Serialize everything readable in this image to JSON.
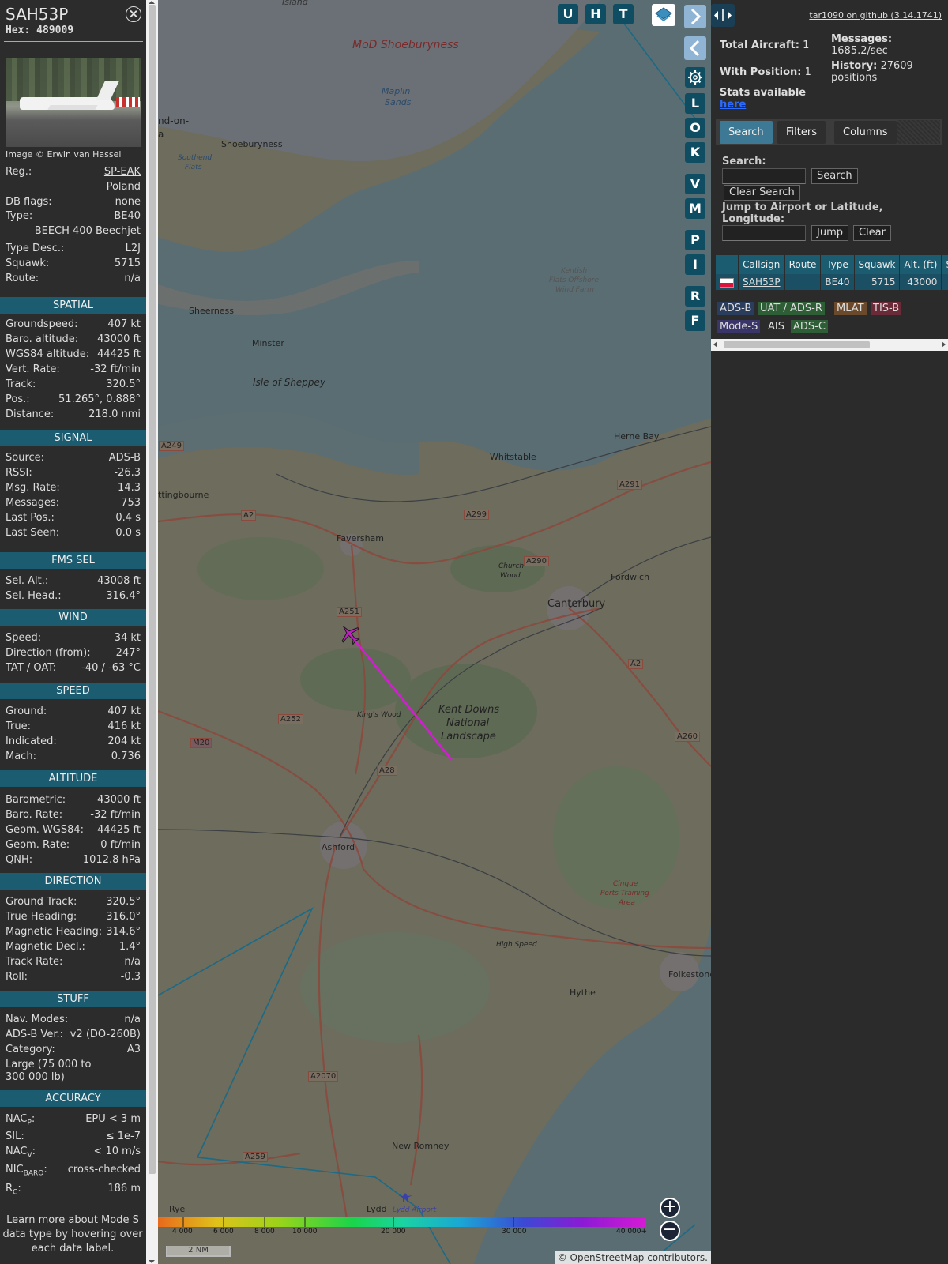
{
  "aircraft": {
    "callsign": "SAH53P",
    "hex_label": "Hex:",
    "hex": "489009",
    "photo_credit": "Image © Erwin van Hassel",
    "reg_label": "Reg.:",
    "reg": "SP-EAK",
    "country": "Poland",
    "dbflags_label": "DB flags:",
    "dbflags": "none",
    "type_label": "Type:",
    "type": "BE40",
    "type_name": "BEECH 400 Beechjet",
    "typedesc_label": "Type Desc.:",
    "typedesc": "L2J",
    "squawk_label": "Squawk:",
    "squawk": "5715",
    "route_label": "Route:",
    "route": "n/a"
  },
  "sections": {
    "spatial": "SPATIAL",
    "signal": "SIGNAL",
    "fms": "FMS SEL",
    "wind": "WIND",
    "speed": "SPEED",
    "altitude": "ALTITUDE",
    "direction": "DIRECTION",
    "stuff": "STUFF",
    "accuracy": "ACCURACY"
  },
  "spatial": [
    {
      "k": "Groundspeed:",
      "v": "407 kt"
    },
    {
      "k": "Baro. altitude:",
      "v": "43000 ft"
    },
    {
      "k": "WGS84 altitude:",
      "v": "44425 ft"
    },
    {
      "k": "Vert. Rate:",
      "v": "-32 ft/min"
    },
    {
      "k": "Track:",
      "v": "320.5°"
    },
    {
      "k": "Pos.:",
      "v": "51.265°, 0.888°"
    },
    {
      "k": "Distance:",
      "v": "218.0 nmi"
    }
  ],
  "signal": [
    {
      "k": "Source:",
      "v": "ADS-B"
    },
    {
      "k": "RSSI:",
      "v": "-26.3"
    },
    {
      "k": "Msg. Rate:",
      "v": "14.3"
    },
    {
      "k": "Messages:",
      "v": "753"
    },
    {
      "k": "Last Pos.:",
      "v": "0.4 s"
    },
    {
      "k": "Last Seen:",
      "v": "0.0 s"
    }
  ],
  "fms": [
    {
      "k": "Sel. Alt.:",
      "v": "43008 ft"
    },
    {
      "k": "Sel. Head.:",
      "v": "316.4°"
    }
  ],
  "wind": [
    {
      "k": "Speed:",
      "v": "34 kt"
    },
    {
      "k": "Direction (from):",
      "v": "247°"
    },
    {
      "k": "TAT / OAT:",
      "v": "-40 / -63 °C"
    }
  ],
  "speed": [
    {
      "k": "Ground:",
      "v": "407 kt"
    },
    {
      "k": "True:",
      "v": "416 kt"
    },
    {
      "k": "Indicated:",
      "v": "204 kt"
    },
    {
      "k": "Mach:",
      "v": "0.736"
    }
  ],
  "altitude": [
    {
      "k": "Barometric:",
      "v": "43000 ft"
    },
    {
      "k": "Baro. Rate:",
      "v": "-32 ft/min"
    },
    {
      "k": "Geom. WGS84:",
      "v": "44425 ft"
    },
    {
      "k": "Geom. Rate:",
      "v": "0 ft/min"
    },
    {
      "k": "QNH:",
      "v": "1012.8 hPa"
    }
  ],
  "direction": [
    {
      "k": "Ground Track:",
      "v": "320.5°"
    },
    {
      "k": "True Heading:",
      "v": "316.0°"
    },
    {
      "k": "Magnetic Heading:",
      "v": "314.6°"
    },
    {
      "k": "Magnetic Decl.:",
      "v": "1.4°"
    },
    {
      "k": "Track Rate:",
      "v": "n/a"
    },
    {
      "k": "Roll:",
      "v": "-0.3"
    }
  ],
  "stuff": [
    {
      "k": "Nav. Modes:",
      "v": "n/a"
    },
    {
      "k": "ADS-B Ver.:",
      "v": "v2 (DO-260B)"
    },
    {
      "k": "Category:",
      "v": "A3"
    }
  ],
  "stuff_category_desc_1": "Large (75 000 to",
  "stuff_category_desc_2": "300 000 lb)",
  "accuracy": {
    "nacp_k": "NAC",
    "nacp_sub": "P",
    "nacp_v": "EPU < 3 m",
    "sil_k": "SIL:",
    "sil_v": "≤ 1e-7",
    "nacv_k": "NAC",
    "nacv_sub": "V",
    "nacv_v": "< 10 m/s",
    "nic_k": "NIC",
    "nic_sub": "BARO",
    "nic_v": "cross-checked",
    "rc_k": "R",
    "rc_sub": "C",
    "rc_v": "186 m"
  },
  "learn_more_1": "Learn more about Mode S",
  "learn_more_2": "data type by hovering over",
  "learn_more_3": "each data label.",
  "map": {
    "buttons_top": [
      "U",
      "H",
      "T"
    ],
    "buttons_side": [
      "L",
      "O",
      "K",
      "V",
      "M",
      "P",
      "I",
      "R",
      "F"
    ],
    "scale": "2 NM",
    "attribution_prefix": "© ",
    "attribution_link": "OpenStreetMap",
    "attribution_suffix": " contributors.",
    "zoom_in": "+",
    "zoom_out": "−",
    "labels": {
      "island": "Island",
      "shoebury_mod": "MoD Shoeburyness",
      "maplin": "Maplin",
      "sands": "Sands",
      "endon": "nd-on-",
      "endon2": "a",
      "shoeburyness": "Shoeburyness",
      "southend": "Southend",
      "flats": "Flats",
      "kentish": "Kentish",
      "flats_offshore": "Flats Offshore",
      "windfarm": "Wind Farm",
      "sheerness": "Sheerness",
      "minster": "Minster",
      "sheppey": "Isle of Sheppey",
      "herne_bay": "Herne Bay",
      "whitstable": "Whitstable",
      "sittingbourne": "ttingbourne",
      "faversham": "Faversham",
      "church": "Church",
      "wood": "Wood",
      "fordwich": "Fordwich",
      "canterbury": "Canterbury",
      "kent_downs": "Kent Downs",
      "national": "National",
      "landscape": "Landscape",
      "kings_wood": "King's Wood",
      "ashford": "Ashford",
      "cinque": "Cinque",
      "ports_training": "Ports Training",
      "area": "Area",
      "high_speed": "High Speed",
      "folkestone": "Folkestone",
      "hythe": "Hythe",
      "new_romney": "New Romney",
      "rye": "Rye",
      "lydd": "Lydd",
      "lydd_airport": "Lydd Airport",
      "r_a249": "A249",
      "r_a2": "A2",
      "r_a299": "A299",
      "r_a291": "A291",
      "r_a290": "A290",
      "r_a251": "A251",
      "r_a2b": "A2",
      "r_a252": "A252",
      "r_m20": "M20",
      "r_a28": "A28",
      "r_a260": "A260",
      "r_a2070": "A2070",
      "r_a259": "A259"
    },
    "alt_ticks": [
      "4 000",
      "6 000",
      "8 000",
      "10 000",
      "20 000",
      "30 000",
      "40 000+"
    ]
  },
  "right": {
    "github": "tar1090 on github (3.14.1741)",
    "total_label": "Total Aircraft:",
    "total": "1",
    "withpos_label": "With Position:",
    "withpos": "1",
    "messages_label": "Messages:",
    "messages": "1685.2/sec",
    "history_label": "History:",
    "history": "27609",
    "history_unit": "positions",
    "stats_label": "Stats available",
    "stats_link": "here",
    "tabs": [
      "Search",
      "Filters",
      "Columns"
    ],
    "search_label": "Search:",
    "search_btn": "Search",
    "clear_search_btn": "Clear Search",
    "jump_label_1": "Jump to Airport or Latitude,",
    "jump_label_2": "Longitude:",
    "jump_btn": "Jump",
    "clear_btn": "Clear",
    "columns": [
      "",
      "Callsign",
      "Route",
      "Type",
      "Squawk",
      "Alt. (ft)",
      "Spd."
    ],
    "rows": [
      {
        "callsign": "SAH53P",
        "route": "",
        "type": "BE40",
        "squawk": "5715",
        "alt": "43000",
        "spd": ""
      }
    ],
    "legend": [
      {
        "label": "ADS-B",
        "color": "#2b3d5c"
      },
      {
        "label": "UAT / ADS-R",
        "color": "#2e5e35"
      },
      {
        "label": "MLAT",
        "color": "#6b4a2b"
      },
      {
        "label": "TIS-B",
        "color": "#6b2a38"
      },
      {
        "label": "Mode-S",
        "color": "#3a3568"
      },
      {
        "label": "AIS",
        "color": "#2b2b2b"
      },
      {
        "label": "ADS-C",
        "color": "#2e5e35"
      }
    ]
  }
}
